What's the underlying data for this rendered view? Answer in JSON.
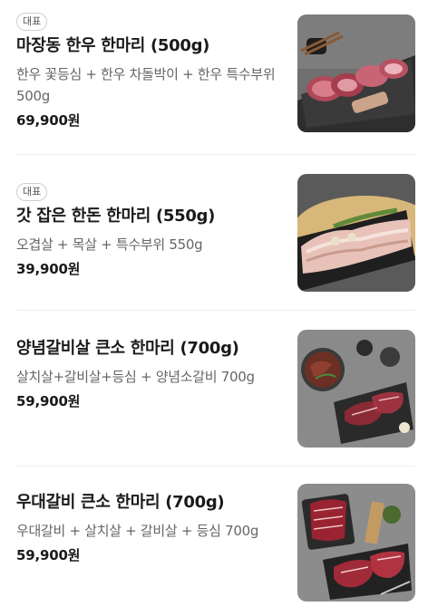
{
  "menu": {
    "items": [
      {
        "badge": "대표",
        "title": "마장동 한우 한마리 (500g)",
        "description": "한우 꽃등심 + 한우 차돌박이 + 한우 특수부위 500g",
        "price": "69,900원",
        "image": "hanwoo-platter-photo"
      },
      {
        "badge": "대표",
        "title": "갓 잡은 한돈 한마리 (550g)",
        "description": "오겹살 + 목살 + 특수부위 550g",
        "price": "39,900원",
        "image": "pork-platter-photo"
      },
      {
        "title": "양념갈비살 큰소 한마리 (700g)",
        "description": "살치살+갈비살+등심 + 양념소갈비 700g",
        "price": "59,900원",
        "image": "marinated-galbi-photo"
      },
      {
        "title": "우대갈비 큰소 한마리 (700g)",
        "description": "우대갈비 + 살치살 + 갈비살 + 등심 700g",
        "price": "59,900원",
        "image": "beef-rib-platter-photo"
      }
    ]
  }
}
